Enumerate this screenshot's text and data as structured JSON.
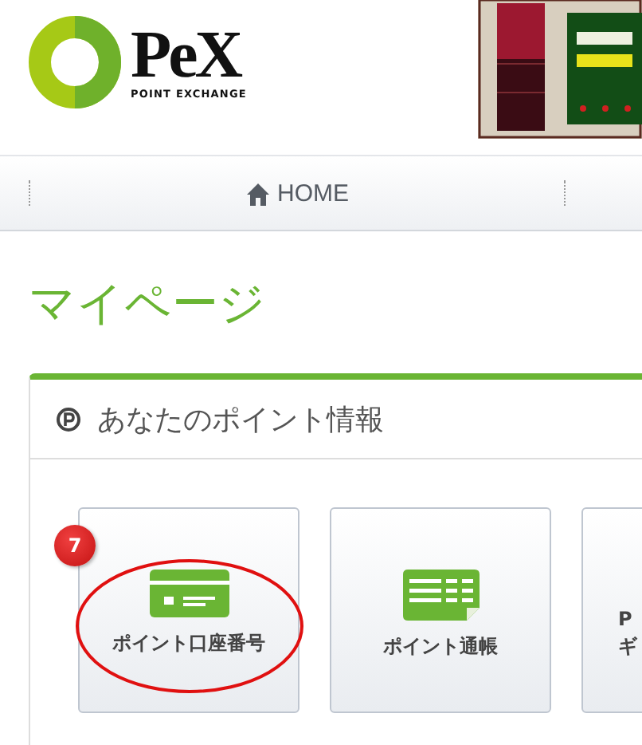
{
  "header": {
    "logo": {
      "name": "PeX",
      "tagline": "POINT EXCHANGE"
    }
  },
  "nav": {
    "items": [
      {
        "label": "HOME"
      }
    ]
  },
  "page_title": "マイページ",
  "panel": {
    "title": "あなたのポイント情報",
    "tiles": [
      {
        "kind": "card",
        "lines": [
          "ポイント口座番号"
        ],
        "badge": "7",
        "circled": true
      },
      {
        "kind": "passbook",
        "lines": [
          "ポイント通帳"
        ],
        "circled": false
      },
      {
        "kind": "none",
        "lines": [
          "P",
          "ギ"
        ],
        "circled": false
      }
    ]
  }
}
